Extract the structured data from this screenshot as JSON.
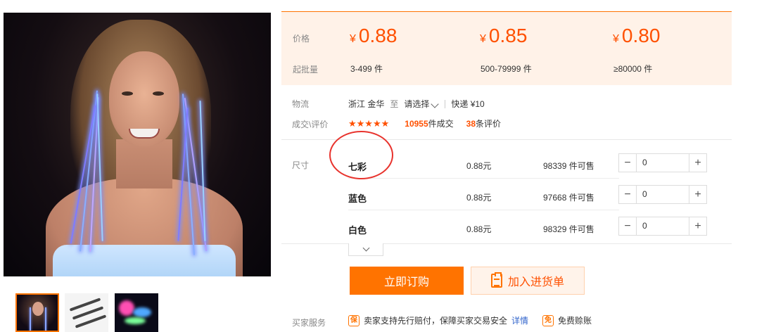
{
  "price_box": {
    "price_label": "价格",
    "moq_label": "起批量",
    "currency": "¥",
    "tiers": [
      {
        "price": "0.88",
        "range": "3-499 件"
      },
      {
        "price": "0.85",
        "range": "500-79999 件"
      },
      {
        "price": "0.80",
        "range": "≥80000 件"
      }
    ]
  },
  "logistics": {
    "label": "物流",
    "origin": "浙江 金华",
    "to": "至",
    "destination_placeholder": "请选择",
    "express": "快递 ¥10"
  },
  "rating": {
    "label": "成交\\评价",
    "stars": "★★★★★",
    "deals_count": "10955",
    "deals_suffix": "件成交",
    "reviews_count": "38",
    "reviews_suffix": "条评价",
    "star_value": 4.5
  },
  "sku": {
    "label": "尺寸",
    "rows": [
      {
        "name": "七彩",
        "price": "0.88元",
        "stock": "98339 件可售",
        "qty": "0"
      },
      {
        "name": "蓝色",
        "price": "0.88元",
        "stock": "97668 件可售",
        "qty": "0"
      },
      {
        "name": "白色",
        "price": "0.88元",
        "stock": "98329 件可售",
        "qty": "0"
      }
    ],
    "minus": "−",
    "plus": "+"
  },
  "actions": {
    "buy_now": "立即订购",
    "add_to_list": "加入进货单"
  },
  "services": {
    "label": "买家服务",
    "guarantee_icon": "保",
    "guarantee_text": "卖家支持先行赔付，保障买家交易安全",
    "details_link": "详情",
    "free_icon": "免",
    "free_text": "免费赊账"
  },
  "colors": {
    "accent": "#ff7300",
    "price": "#ff5000",
    "annotation_circle": "#e8332d"
  }
}
